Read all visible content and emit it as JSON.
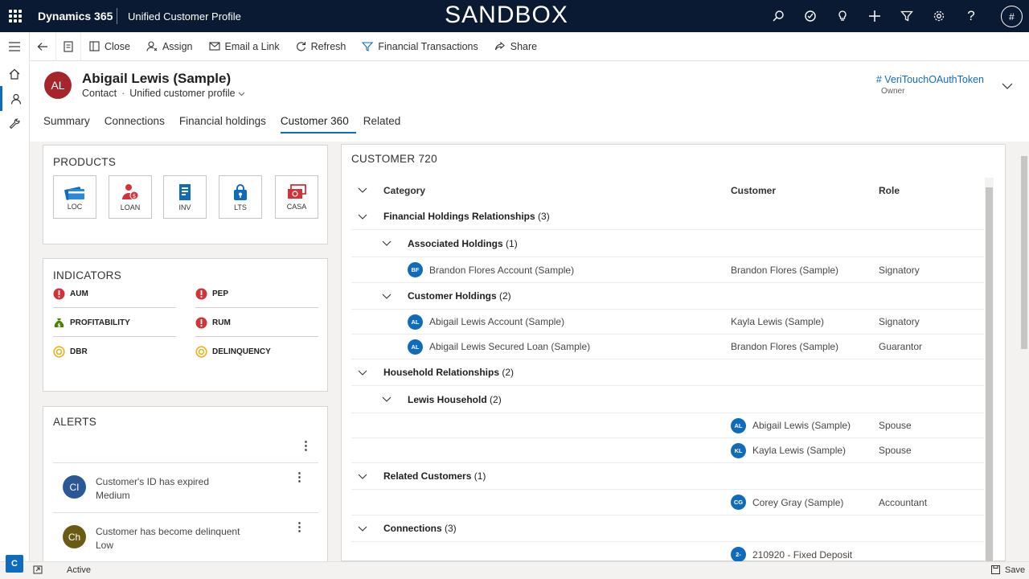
{
  "topbar": {
    "app_name": "Dynamics 365",
    "area_name": "Unified Customer Profile",
    "environment": "SANDBOX",
    "user_initial": "#",
    "icons": [
      "search-icon",
      "task-icon",
      "lightbulb-icon",
      "plus-icon",
      "filter-icon",
      "gear-icon",
      "help-icon"
    ]
  },
  "commands": {
    "close": "Close",
    "assign": "Assign",
    "email_link": "Email a Link",
    "refresh": "Refresh",
    "financial_transactions": "Financial Transactions",
    "share": "Share"
  },
  "record": {
    "initials": "AL",
    "name": "Abigail Lewis (Sample)",
    "entity": "Contact",
    "dot": "·",
    "form": "Unified customer profile",
    "owner_value": "# VeriTouchOAuthToken",
    "owner_label": "Owner",
    "avatar_color": "#a4262c"
  },
  "tabs": [
    "Summary",
    "Connections",
    "Financial holdings",
    "Customer 360",
    "Related"
  ],
  "products": {
    "title": "PRODUCTS",
    "items": [
      {
        "label": "LOC",
        "icon": "credit-card-icon"
      },
      {
        "label": "LOAN",
        "icon": "loan-person-icon"
      },
      {
        "label": "INV",
        "icon": "investment-document-icon"
      },
      {
        "label": "LTS",
        "icon": "lock-bag-icon"
      },
      {
        "label": "CASA",
        "icon": "cash-icon"
      }
    ]
  },
  "indicators": {
    "title": "INDICATORS",
    "items": [
      {
        "label": "AUM",
        "status": "alert"
      },
      {
        "label": "PEP",
        "status": "alert"
      },
      {
        "label": "PROFITABILITY",
        "status": "money"
      },
      {
        "label": "RUM",
        "status": "alert"
      },
      {
        "label": "DBR",
        "status": "neutral"
      },
      {
        "label": "DELINQUENCY",
        "status": "neutral"
      }
    ]
  },
  "alerts": {
    "title": "ALERTS",
    "items": [
      {
        "initials": "CI",
        "title": "Customer's ID has expired",
        "severity": "Medium",
        "color": "#2b5797"
      },
      {
        "initials": "Ch",
        "title": "Customer has become delinquent",
        "severity": "Low",
        "color": "#6b5a12"
      }
    ]
  },
  "customer720": {
    "title": "CUSTOMER 720",
    "columns": {
      "category": "Category",
      "customer": "Customer",
      "role": "Role"
    },
    "rows": [
      {
        "type": "group",
        "level": 0,
        "label": "Financial Holdings Relationships",
        "count": "(3)"
      },
      {
        "type": "group",
        "level": 1,
        "label": "Associated Holdings",
        "count": "(1)"
      },
      {
        "type": "item",
        "initials": "BF",
        "category": "Brandon Flores Account (Sample)",
        "customer": "Brandon Flores (Sample)",
        "role": "Signatory"
      },
      {
        "type": "group",
        "level": 1,
        "label": "Customer Holdings",
        "count": "(2)"
      },
      {
        "type": "item",
        "initials": "AL",
        "category": "Abigail Lewis Account (Sample)",
        "customer": "Kayla Lewis (Sample)",
        "role": "Signatory"
      },
      {
        "type": "item",
        "initials": "AL",
        "category": "Abigail Lewis Secured Loan (Sample)",
        "customer": "Brandon Flores (Sample)",
        "role": "Guarantor"
      },
      {
        "type": "group",
        "level": 0,
        "label": "Household Relationships",
        "count": "(2)"
      },
      {
        "type": "group",
        "level": 1,
        "label": "Lewis Household",
        "count": "(2)"
      },
      {
        "type": "member",
        "initials": "AL",
        "customer": "Abigail Lewis (Sample)",
        "role": "Spouse"
      },
      {
        "type": "member",
        "initials": "KL",
        "customer": "Kayla Lewis (Sample)",
        "role": "Spouse"
      },
      {
        "type": "group",
        "level": 0,
        "label": "Related Customers",
        "count": "(1)"
      },
      {
        "type": "member",
        "initials": "CG",
        "customer": "Corey Gray (Sample)",
        "role": "Accountant"
      },
      {
        "type": "group",
        "level": 0,
        "label": "Connections",
        "count": "(3)"
      },
      {
        "type": "member",
        "initials": "2-",
        "customer": "210920 - Fixed Deposit",
        "role": ""
      }
    ]
  },
  "statusbar": {
    "badge": "C",
    "status": "Active",
    "save": "Save"
  },
  "colors": {
    "accent": "#0f6cbd",
    "topbar": "#0b1a33",
    "alert_red": "#d13438",
    "money_green": "#498205",
    "neutral_yellow": "#e8b31c"
  }
}
